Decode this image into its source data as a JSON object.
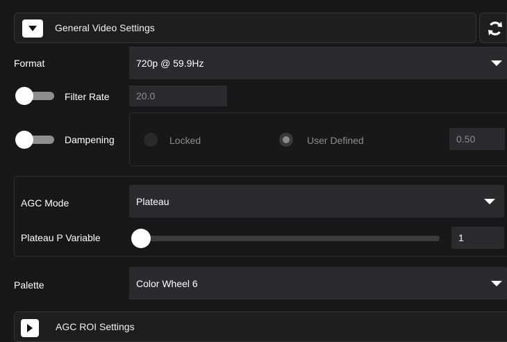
{
  "general_header": {
    "title": "General Video Settings",
    "expand_icon": "chevron-down-icon",
    "refresh_icon": "refresh-icon"
  },
  "format": {
    "label": "Format",
    "value": "720p @ 59.9Hz"
  },
  "filter_rate": {
    "label": "Filter Rate",
    "toggle_on": false,
    "value": "20.0"
  },
  "dampening": {
    "label": "Dampening",
    "toggle_on": false,
    "options": [
      "Locked",
      "User Defined"
    ],
    "selected": "User Defined",
    "value": "0.50"
  },
  "agc": {
    "mode_label": "AGC Mode",
    "mode_value": "Plateau",
    "plateau_label": "Plateau P Variable",
    "plateau_value": "1",
    "slider_fraction": 0.0
  },
  "palette": {
    "label": "Palette",
    "value": "Color Wheel 6"
  },
  "roi_header": {
    "title": "AGC ROI Settings",
    "expand_icon": "chevron-right-icon"
  },
  "colors": {
    "background": "#181818",
    "field": "#2b2b2e",
    "toggle_track": "#8e8e8e",
    "muted_text": "#8d8d8d"
  }
}
